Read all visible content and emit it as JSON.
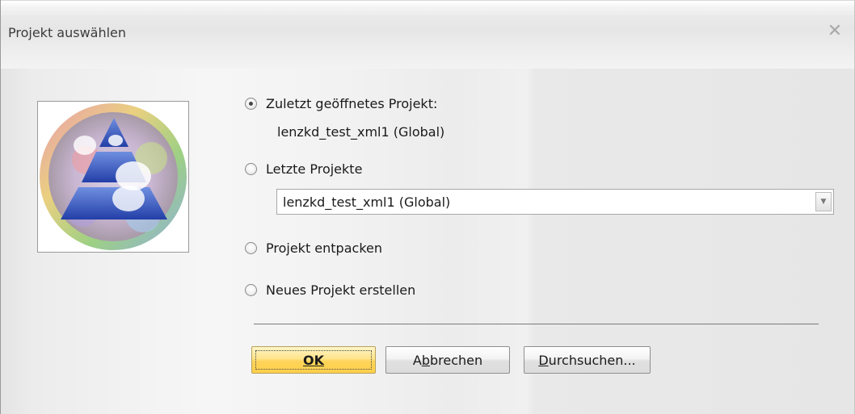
{
  "window": {
    "title": "Projekt auswählen",
    "close_glyph": "✕"
  },
  "logo": {
    "icon": "project-logo-pyramid-icon"
  },
  "options": {
    "recent_opened_label": "Zuletzt geöffnetes Projekt:",
    "recent_opened_value": "lenzkd_test_xml1 (Global)",
    "recent_projects_label": "Letzte Projekte",
    "recent_projects_selected": "lenzkd_test_xml1 (Global)",
    "unpack_label": "Projekt entpacken",
    "new_label": "Neues Projekt erstellen",
    "checked": "recent_opened"
  },
  "buttons": {
    "ok": "OK",
    "cancel_pre": "A",
    "cancel_mnemonic": "b",
    "cancel_post": "brechen",
    "browse_mnemonic": "D",
    "browse_post": "urchsuchen..."
  },
  "colors": {
    "default_button": "#ffd45a",
    "border": "#9a9a9a"
  }
}
